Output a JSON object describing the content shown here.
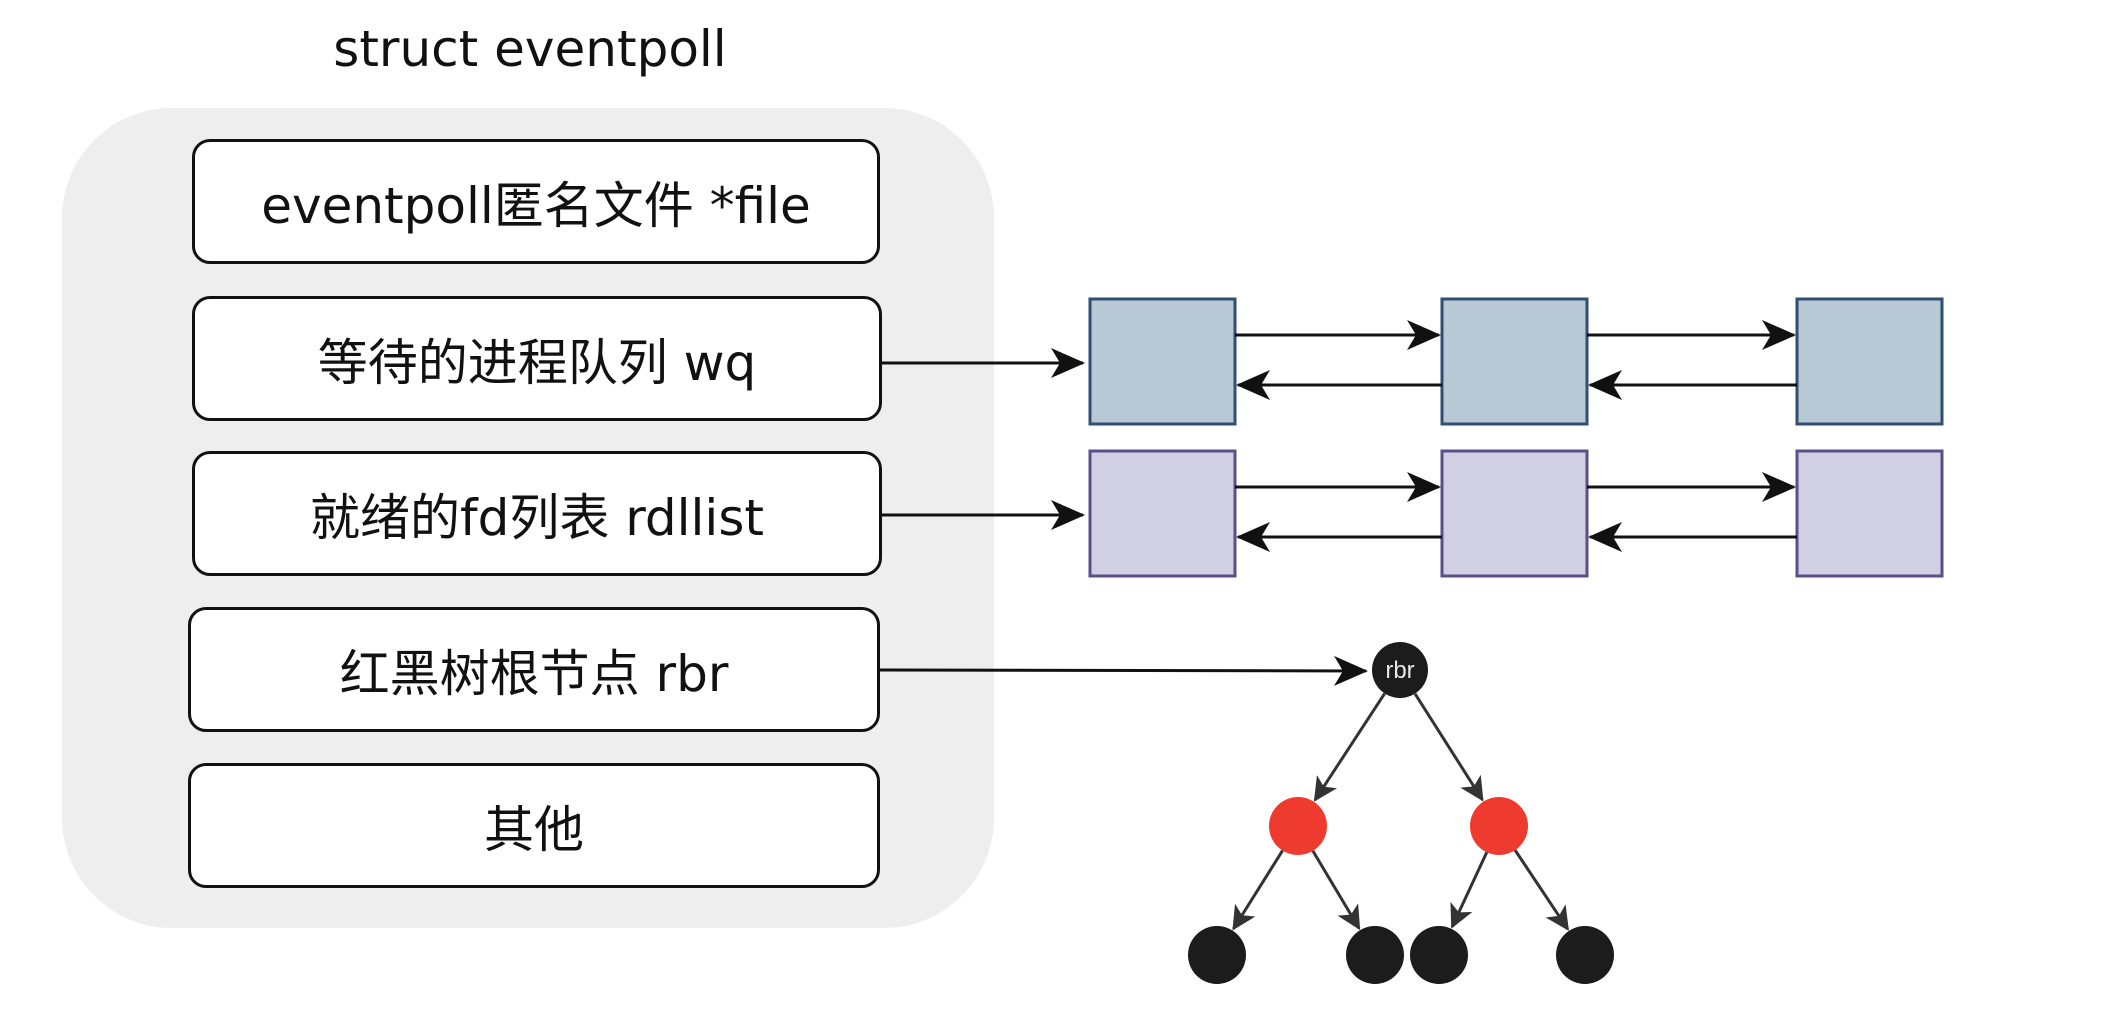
{
  "title": "struct eventpoll",
  "fields": [
    {
      "label": "eventpoll匿名文件 *file"
    },
    {
      "label": "等待的进程队列 wq"
    },
    {
      "label": "就绪的fd列表 rdllist"
    },
    {
      "label": "红黑树根节点 rbr"
    },
    {
      "label": "其他"
    }
  ],
  "wq_list": {
    "node_count": 3,
    "fill": "#b8c9d5",
    "stroke": "#2f4f70"
  },
  "rdllist_list": {
    "node_count": 3,
    "fill": "#d0cfe4",
    "stroke": "#5d4f86"
  },
  "tree": {
    "root_label": "rbr",
    "colors": {
      "black": "#1c1c1c",
      "red": "#ee3a2f"
    },
    "levels": [
      [
        "black"
      ],
      [
        "red",
        "red"
      ],
      [
        "black",
        "black",
        "black",
        "black"
      ]
    ]
  }
}
